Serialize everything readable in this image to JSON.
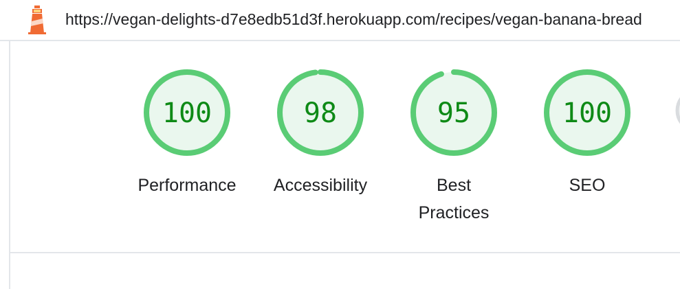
{
  "header": {
    "url": "https://vegan-delights-d7e8edb51d3f.herokuapp.com/recipes/vegan-banana-bread",
    "logo_icon": "lighthouse-icon"
  },
  "gauges": [
    {
      "score": "100",
      "value": 100,
      "label": "Performance",
      "color": "#0cce6b"
    },
    {
      "score": "98",
      "value": 98,
      "label": "Accessibility",
      "color": "#0cce6b"
    },
    {
      "score": "95",
      "value": 95,
      "label": "Best Practices",
      "color": "#0cce6b"
    },
    {
      "score": "100",
      "value": 100,
      "label": "SEO",
      "color": "#0cce6b"
    }
  ],
  "colors": {
    "pass_ring": "#5acc75",
    "pass_fill": "#eaf7ee",
    "pass_text": "#0e8a16",
    "divider": "#e3e6ea"
  }
}
